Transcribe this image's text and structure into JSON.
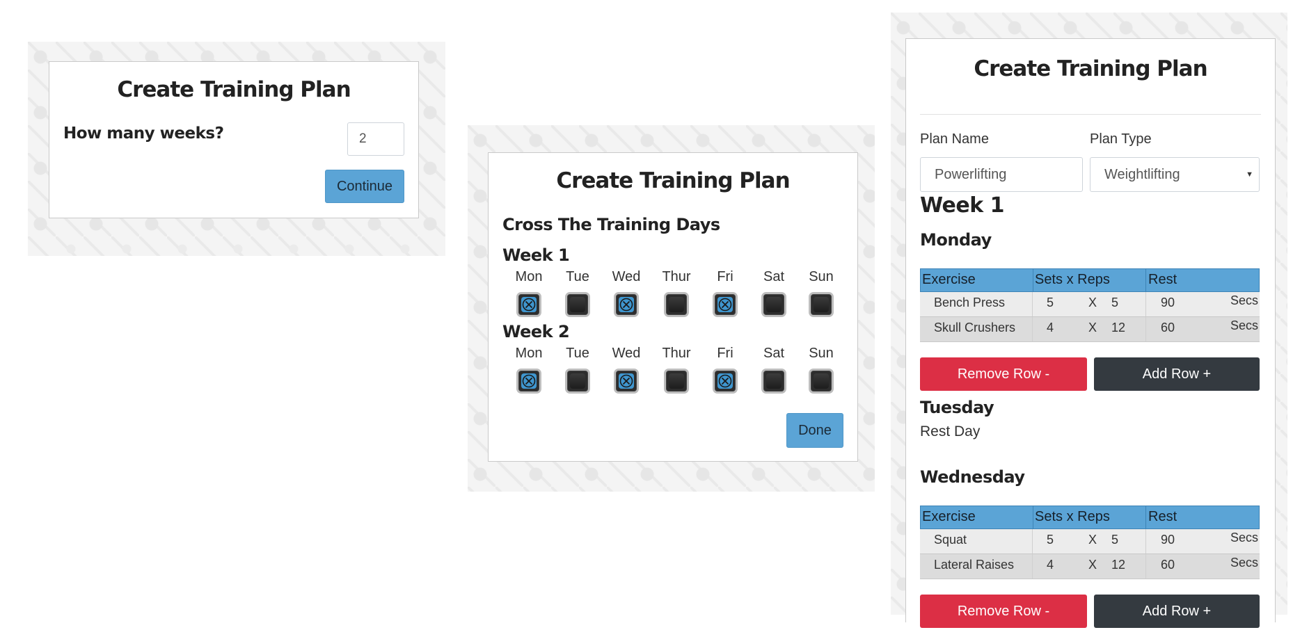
{
  "panel1": {
    "title": "Create Training Plan",
    "question": "How many weeks?",
    "weeks_value": "2",
    "continue_label": "Continue"
  },
  "panel2": {
    "title": "Create Training Plan",
    "subtitle": "Cross The Training Days",
    "weeks": [
      {
        "label": "Week 1",
        "days": [
          {
            "name": "Mon",
            "checked": true
          },
          {
            "name": "Tue",
            "checked": false
          },
          {
            "name": "Wed",
            "checked": true
          },
          {
            "name": "Thur",
            "checked": false
          },
          {
            "name": "Fri",
            "checked": true
          },
          {
            "name": "Sat",
            "checked": false
          },
          {
            "name": "Sun",
            "checked": false
          }
        ]
      },
      {
        "label": "Week 2",
        "days": [
          {
            "name": "Mon",
            "checked": true
          },
          {
            "name": "Tue",
            "checked": false
          },
          {
            "name": "Wed",
            "checked": true
          },
          {
            "name": "Thur",
            "checked": false
          },
          {
            "name": "Fri",
            "checked": true
          },
          {
            "name": "Sat",
            "checked": false
          },
          {
            "name": "Sun",
            "checked": false
          }
        ]
      }
    ],
    "done_label": "Done"
  },
  "panel3": {
    "title": "Create Training Plan",
    "plan_name_label": "Plan Name",
    "plan_name_value": "Powerlifting",
    "plan_type_label": "Plan Type",
    "plan_type_value": "Weightlifting",
    "week_label": "Week 1",
    "table_headers": [
      "Exercise",
      "Sets x Reps",
      "Rest"
    ],
    "days": [
      {
        "name": "Monday",
        "rows": [
          {
            "exercise": "Bench Press",
            "sets": "5",
            "x": "X",
            "reps": "5",
            "rest": "90",
            "unit": "Secs"
          },
          {
            "exercise": "Skull Crushers",
            "sets": "4",
            "x": "X",
            "reps": "12",
            "rest": "60",
            "unit": "Secs"
          }
        ]
      },
      {
        "name": "Tuesday",
        "rest_text": "Rest Day"
      },
      {
        "name": "Wednesday",
        "rows": [
          {
            "exercise": "Squat",
            "sets": "5",
            "x": "X",
            "reps": "5",
            "rest": "90",
            "unit": "Secs"
          },
          {
            "exercise": "Lateral Raises",
            "sets": "4",
            "x": "X",
            "reps": "12",
            "rest": "60",
            "unit": "Secs"
          }
        ]
      }
    ],
    "remove_row_label": "Remove Row -",
    "add_row_label": "Add Row +"
  },
  "colors": {
    "accent_blue": "#5ba4d6",
    "danger_red": "#dc2f45",
    "dark": "#343a40"
  }
}
